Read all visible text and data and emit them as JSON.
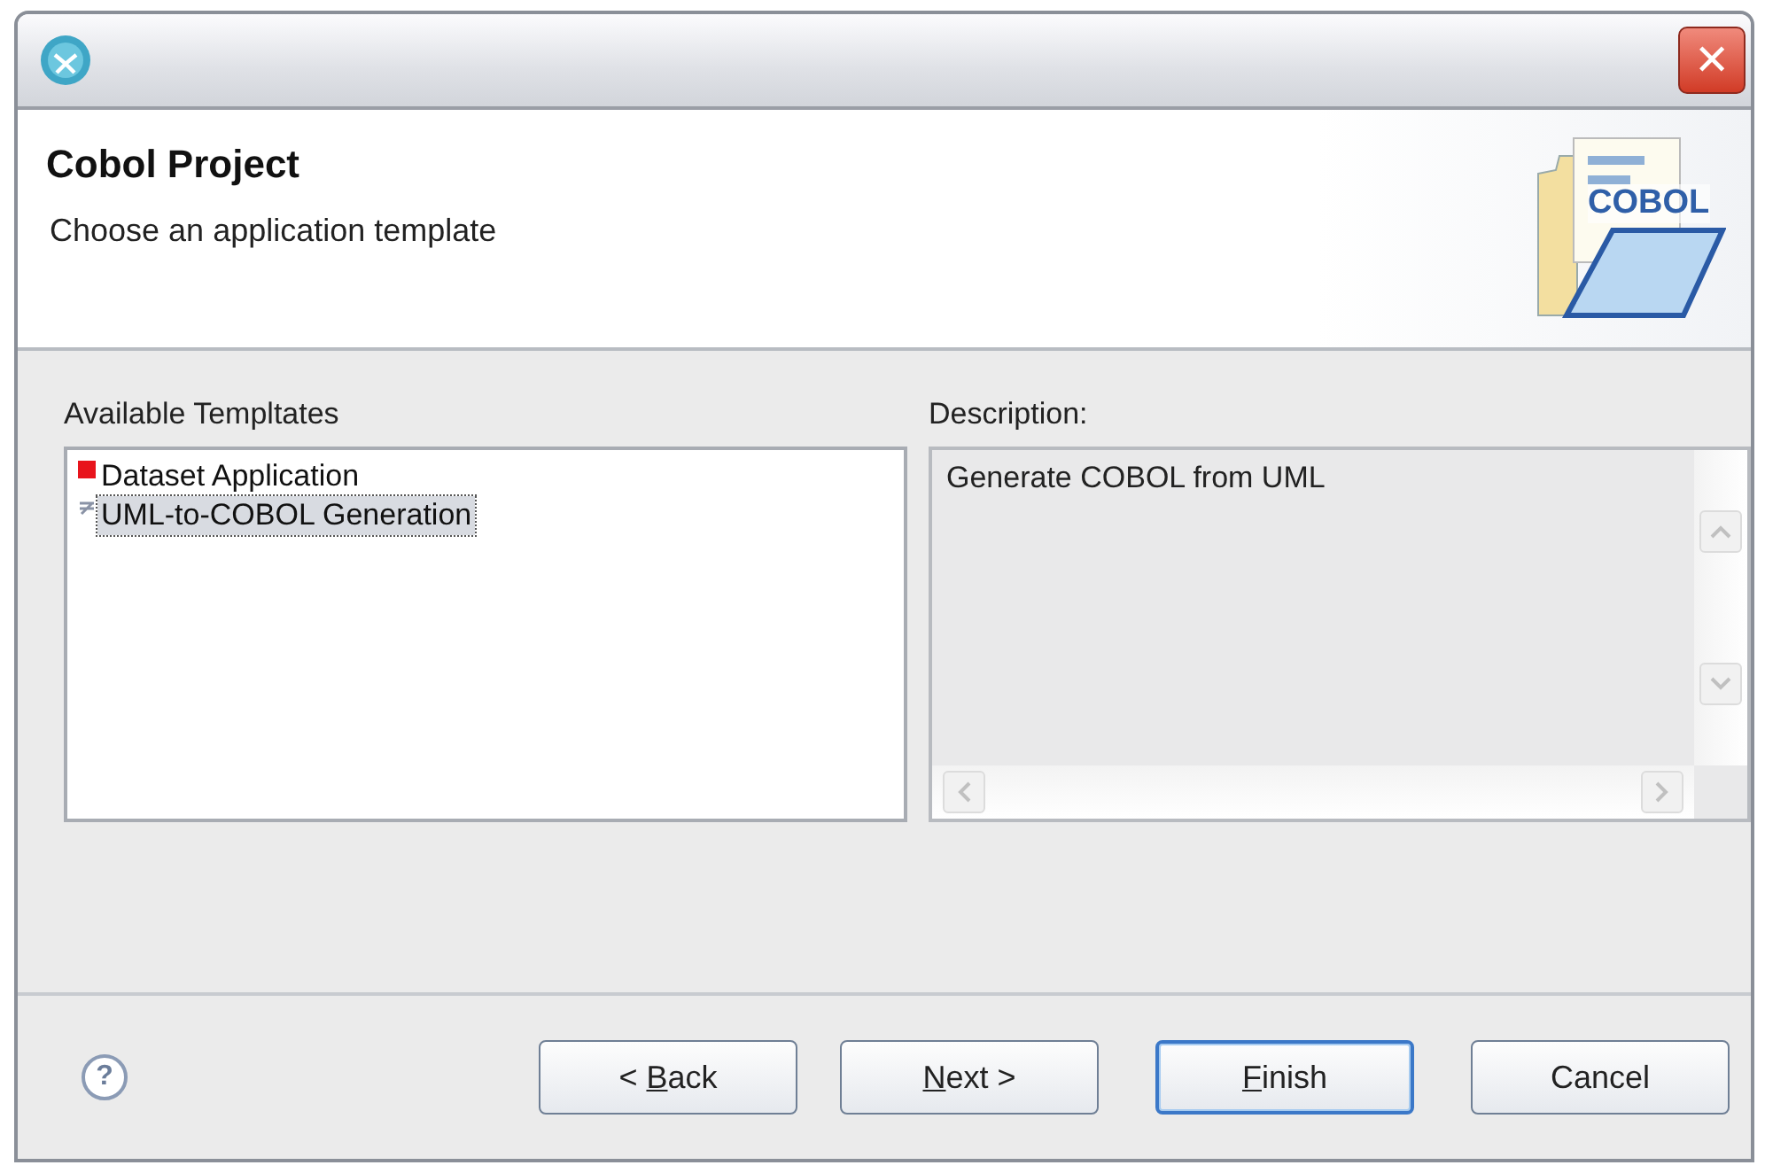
{
  "window": {
    "title_bar": {
      "close_glyph": "✕"
    }
  },
  "header": {
    "title": "Cobol Project",
    "subtitle": "Choose an application template",
    "banner": {
      "label": "COBOL"
    }
  },
  "templates": {
    "label": "Available Templtates",
    "items": [
      {
        "label": "Dataset Application",
        "kind": "dataset",
        "selected": false
      },
      {
        "label": "UML-to-COBOL Generation",
        "kind": "uml",
        "selected": true
      }
    ]
  },
  "description": {
    "label": "Description:",
    "text": "Generate COBOL from UML"
  },
  "footer": {
    "help": "?",
    "buttons": [
      {
        "before": "< ",
        "key": "B",
        "after": "ack",
        "default": false
      },
      {
        "key": "N",
        "after": "ext >",
        "default": false
      },
      {
        "key": "F",
        "after": "inish",
        "default": true
      },
      {
        "before": "Cancel",
        "default": false
      }
    ]
  }
}
